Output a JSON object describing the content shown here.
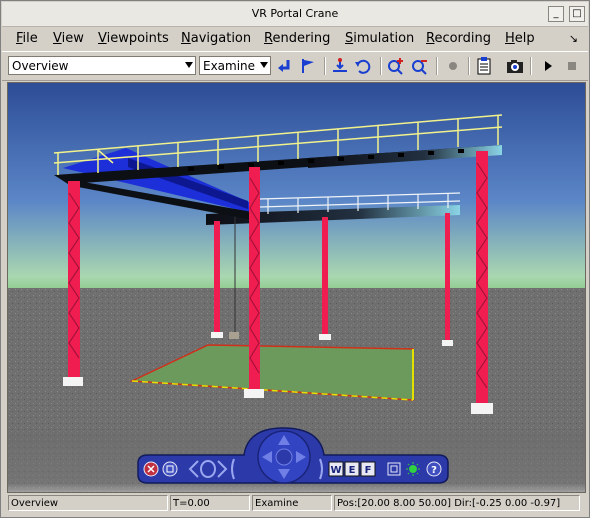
{
  "window": {
    "title": "VR Portal Crane"
  },
  "menu": {
    "items": [
      {
        "label": "File",
        "key": "F",
        "rest": "ile"
      },
      {
        "label": "View",
        "key": "V",
        "rest": "iew"
      },
      {
        "label": "Viewpoints",
        "key": "V",
        "rest": "iewpoints"
      },
      {
        "label": "Navigation",
        "key": "N",
        "rest": "avigation"
      },
      {
        "label": "Rendering",
        "key": "R",
        "rest": "endering"
      },
      {
        "label": "Simulation",
        "key": "S",
        "rest": "imulation"
      },
      {
        "label": "Recording",
        "key": "R",
        "rest": "ecording"
      },
      {
        "label": "Help",
        "key": "H",
        "rest": "elp"
      }
    ]
  },
  "toolbar": {
    "viewpoint_value": "Overview",
    "navigation_mode_value": "Examine"
  },
  "navpanel": {
    "w_label": "W",
    "e_label": "E",
    "f_label": "F",
    "help_label": "?"
  },
  "status": {
    "viewpoint": "Overview",
    "time": "T=0.00",
    "mode": "Examine",
    "position": "Pos:[20.00 8.00 50.00] Dir:[-0.25 0.00 -0.97]"
  },
  "colors": {
    "sky_top": "#2e4f99",
    "horizon": "#7fc67a",
    "ground": "#6d6d6d",
    "column_red": "#f01e50",
    "beam_blue": "#1c2fd8",
    "railing_yellow": "#f2f28c",
    "floor_green": "#6c9a5c",
    "nav_blue": "#2b3aa8"
  }
}
